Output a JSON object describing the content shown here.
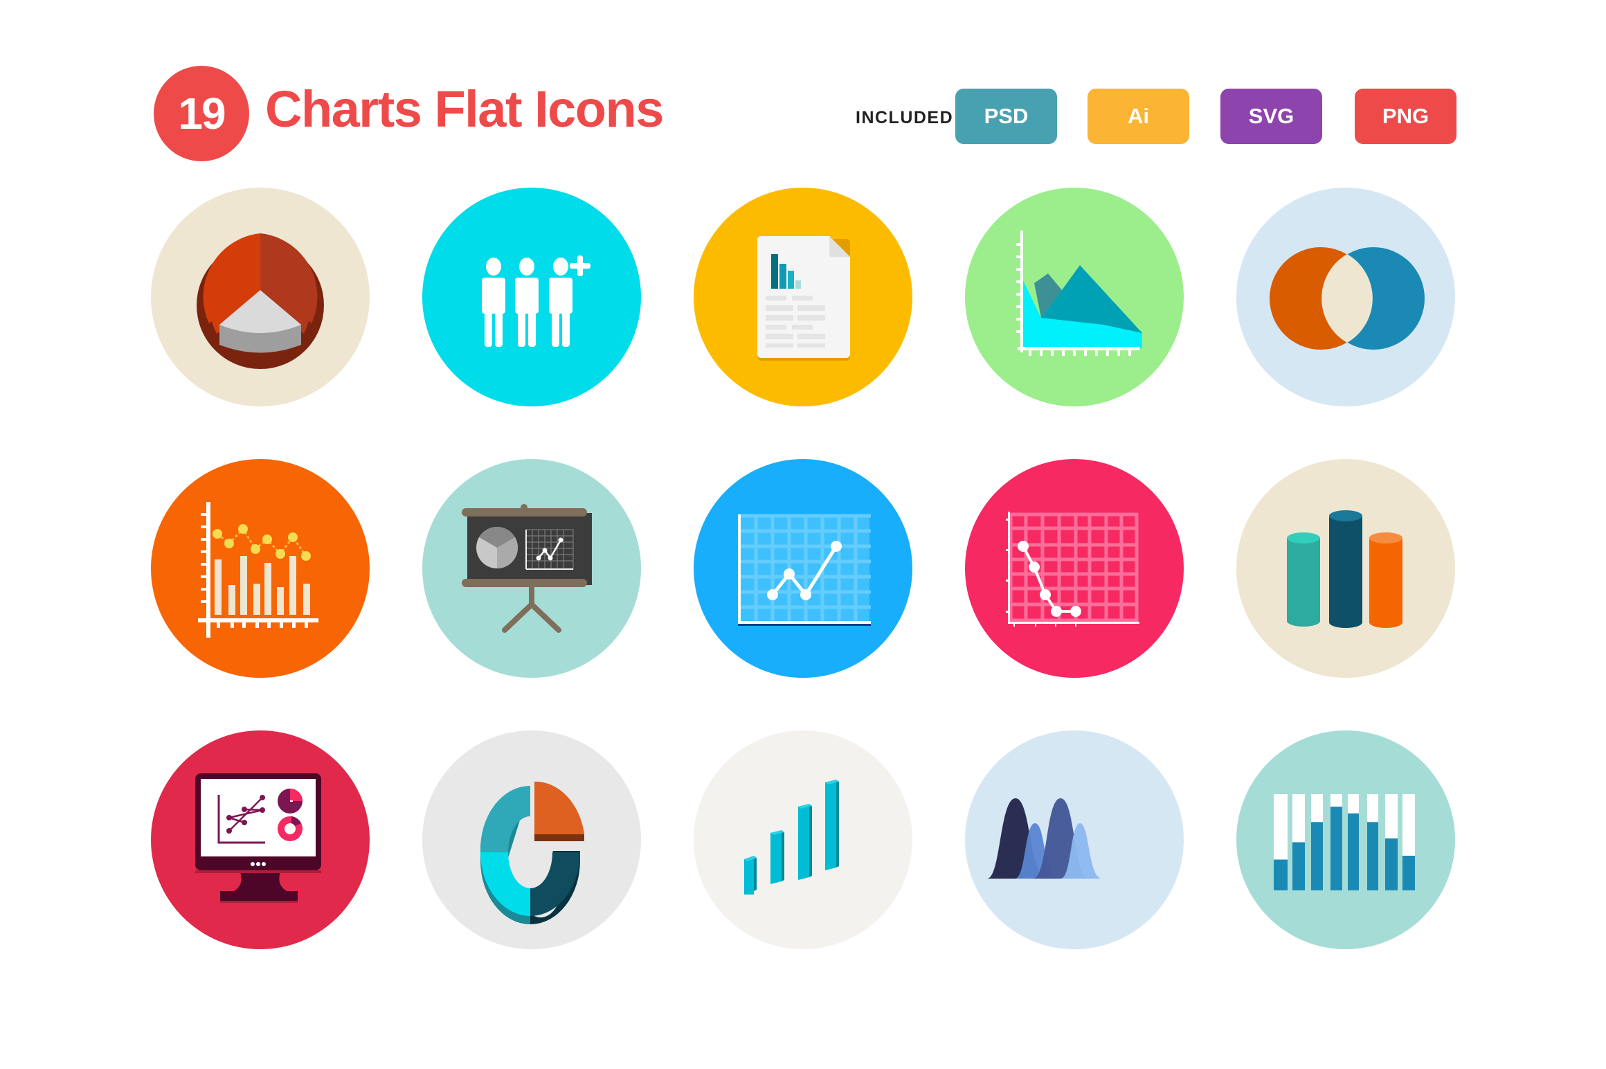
{
  "header": {
    "count": "19",
    "title": "Charts Flat Icons",
    "included_label": "INCLUDED",
    "formats": [
      {
        "label": "PSD",
        "color": "#48a1b0"
      },
      {
        "label": "Ai",
        "color": "#fbb434"
      },
      {
        "label": "SVG",
        "color": "#8e44ad"
      },
      {
        "label": "PNG",
        "color": "#ee4a4a"
      }
    ],
    "accent": "#ee4a4a"
  },
  "icons": [
    {
      "name": "3d-pie-chart-icon",
      "bg": "#efe6d2"
    },
    {
      "name": "add-people-icon",
      "bg": "#00dcea"
    },
    {
      "name": "report-document-icon",
      "bg": "#fdbb00"
    },
    {
      "name": "area-chart-icon",
      "bg": "#9bee8b"
    },
    {
      "name": "venn-diagram-icon",
      "bg": "#d6e7f4"
    },
    {
      "name": "bar-line-combo-chart-icon",
      "bg": "#f86504"
    },
    {
      "name": "presentation-board-icon",
      "bg": "#a5dcd6"
    },
    {
      "name": "grid-line-chart-up-icon",
      "bg": "#19aefc"
    },
    {
      "name": "grid-line-chart-down-icon",
      "bg": "#f62962"
    },
    {
      "name": "3d-cylinder-bars-icon",
      "bg": "#efe6d2"
    },
    {
      "name": "monitor-analytics-icon",
      "bg": "#e0294b"
    },
    {
      "name": "3d-donut-chart-icon",
      "bg": "#e8e8e8"
    },
    {
      "name": "3d-growth-bars-icon",
      "bg": "#f4f2ee"
    },
    {
      "name": "distribution-curves-icon",
      "bg": "#d6e7f4"
    },
    {
      "name": "progress-bars-icon",
      "bg": "#a5dcd6"
    }
  ]
}
